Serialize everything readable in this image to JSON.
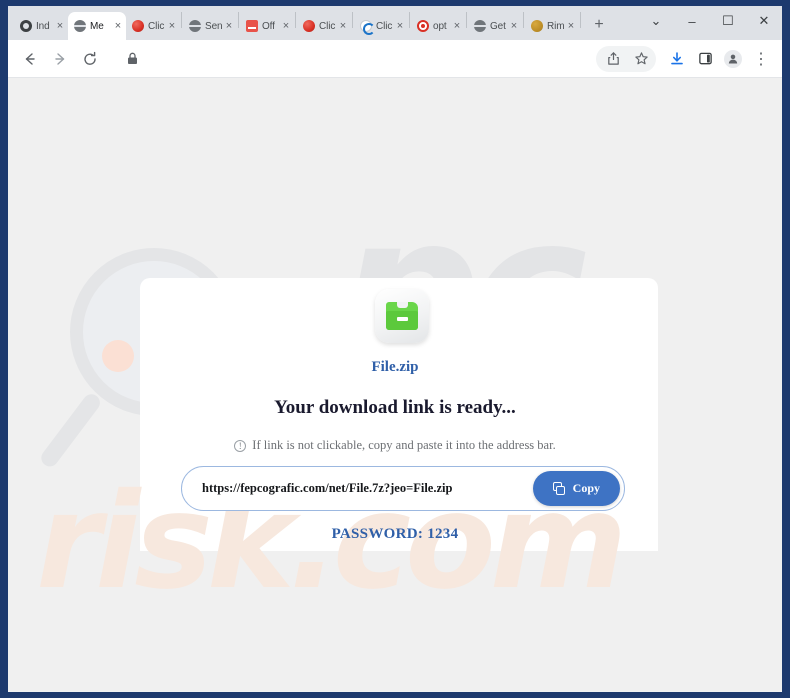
{
  "browser": {
    "tabs": [
      {
        "label": "Ind",
        "favicon": "film-icon",
        "active": false
      },
      {
        "label": "Me",
        "favicon": "globe-icon",
        "active": true
      },
      {
        "label": "Clic",
        "favicon": "red-circle-icon",
        "active": false
      },
      {
        "label": "Sen",
        "favicon": "globe-icon",
        "active": false
      },
      {
        "label": "Off",
        "favicon": "red-square-icon",
        "active": false
      },
      {
        "label": "Clic",
        "favicon": "red-circle-icon",
        "active": false
      },
      {
        "label": "Clic",
        "favicon": "edge-icon",
        "active": false
      },
      {
        "label": "opt",
        "favicon": "target-icon",
        "active": false
      },
      {
        "label": "Get",
        "favicon": "globe-icon",
        "active": false
      },
      {
        "label": "Rim",
        "favicon": "gold-circle-icon",
        "active": false
      }
    ],
    "new_tab_label": "+",
    "tab_close_label": "×",
    "window_controls": {
      "tab_search": "⌄",
      "minimize": "–",
      "maximize": "☐",
      "close": "✕"
    },
    "toolbar": {
      "back": "←",
      "forward": "→",
      "reload": "⟳",
      "site_info_icon": "lock-icon",
      "address_value": "",
      "address_placeholder": "",
      "share": "share-icon",
      "bookmark": "☆",
      "download": "download-icon",
      "side_panel": "side-panel-icon",
      "profile": "profile-icon",
      "menu": "⋮"
    }
  },
  "page": {
    "file_icon": "zip-folder-icon",
    "file_name": "File.zip",
    "headline": "Your download link is ready...",
    "hint_icon": "info-icon",
    "hint_icon_glyph": "!",
    "hint_text": "If link is not clickable, copy and paste it into the address bar.",
    "link_url": "https://fepcografic.com/net/File.7z?jeo=File.zip",
    "copy_button_label": "Copy",
    "copy_button_icon": "copy-icon",
    "password_text": "PASSWORD: 1234",
    "watermark_top": "pc",
    "watermark_bottom": "risk.com",
    "colors": {
      "accent_blue": "#2f5fa8",
      "button_blue": "#3e73c4",
      "zip_green": "#5cc93c",
      "watermark_orange": "#f7e8de",
      "frame_blue": "#1d3a6e"
    }
  }
}
